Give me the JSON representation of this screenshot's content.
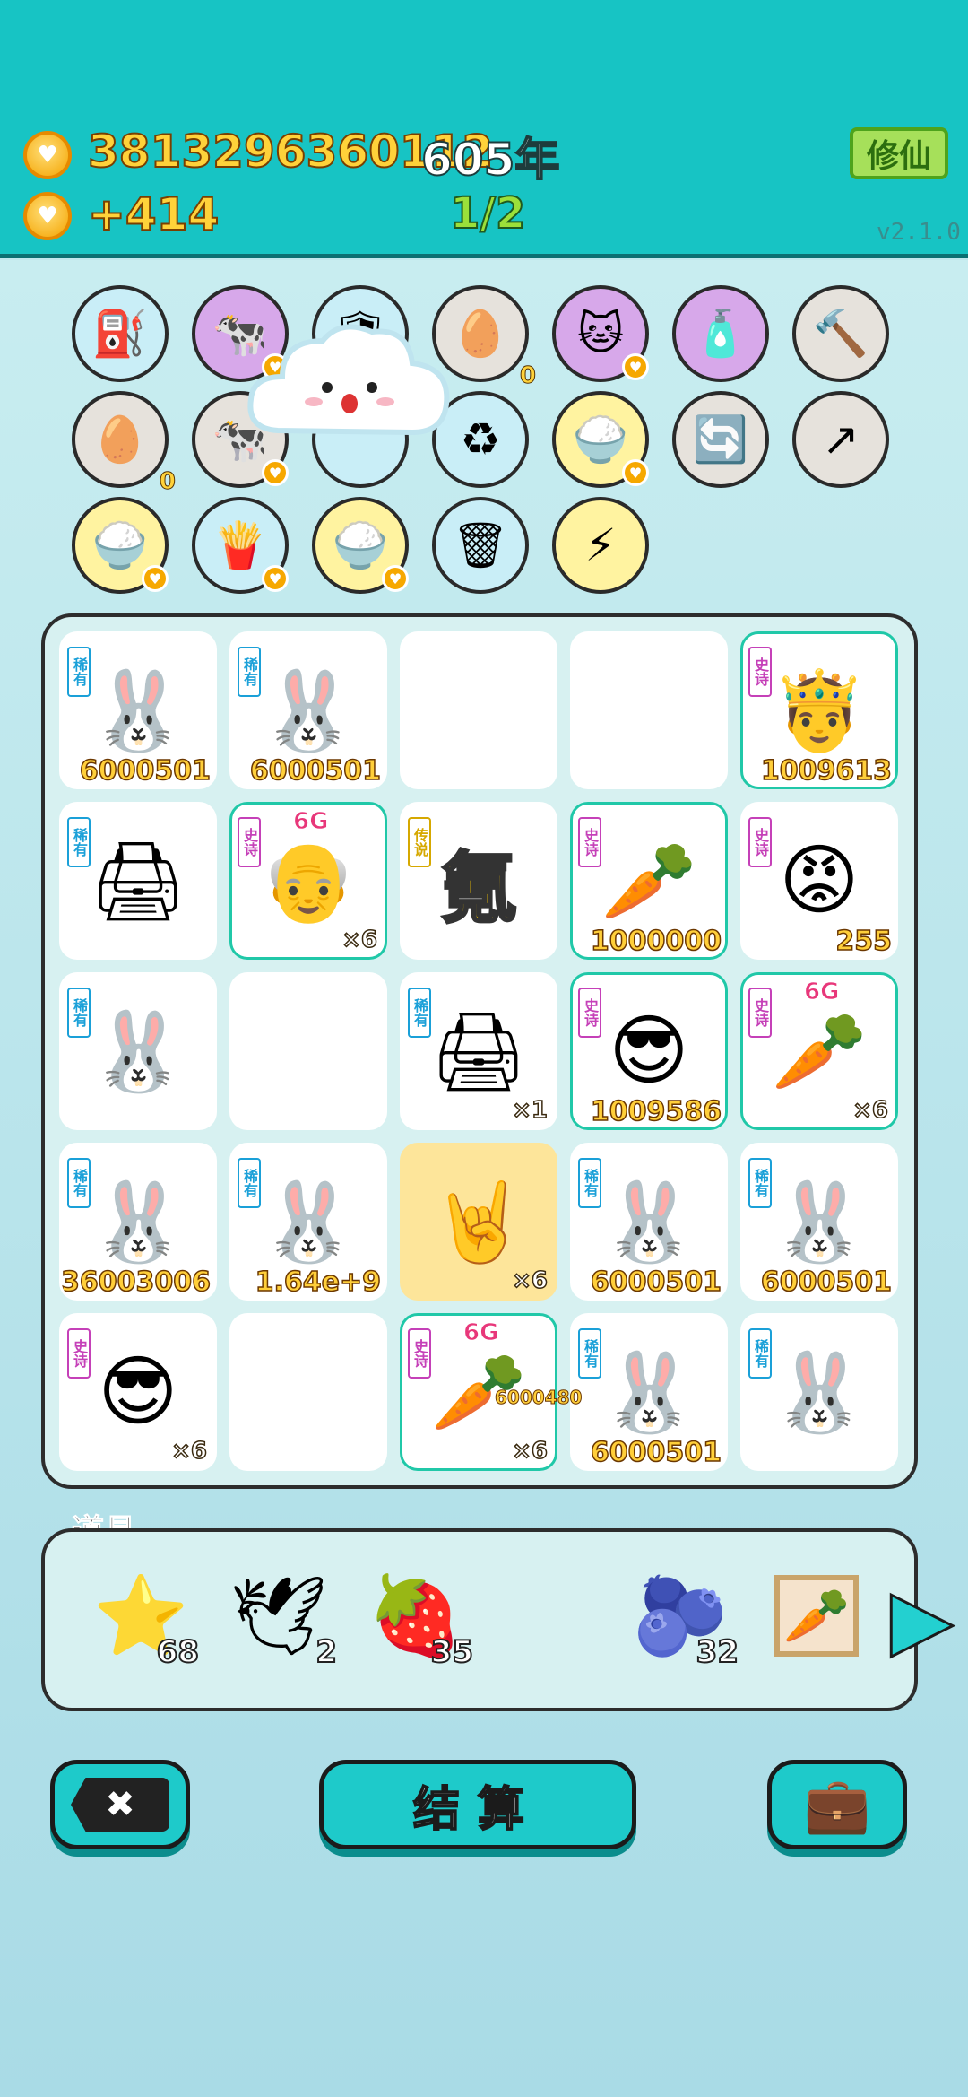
{
  "header": {
    "coins_value": "3813296360112",
    "year_text": "605年",
    "rate_text": "+414",
    "progress_text": "1/2",
    "xiuxian_label": "修仙",
    "version": "v2.1.0"
  },
  "tools": [
    {
      "icon": "pump-icon",
      "glyph": "⛽",
      "bg": "#c9eef7",
      "badge": false,
      "count": ""
    },
    {
      "icon": "cows-icon",
      "glyph": "🐄",
      "bg": "#d7a8ea",
      "badge": true,
      "count": ""
    },
    {
      "icon": "shield-icon",
      "glyph": "🛡",
      "bg": "#c9eef7",
      "badge": false,
      "count": ""
    },
    {
      "icon": "egg-tray-icon",
      "glyph": "🥚",
      "bg": "#e6e2dc",
      "badge": false,
      "count": "0"
    },
    {
      "icon": "cat-icon",
      "glyph": "🐱",
      "bg": "#d7a8ea",
      "badge": true,
      "count": ""
    },
    {
      "icon": "spray-bottle-icon",
      "glyph": "🧴",
      "bg": "#d7a8ea",
      "badge": false,
      "count": ""
    },
    {
      "icon": "hammer-icon",
      "glyph": "🔨",
      "bg": "#e6e2dc",
      "badge": false,
      "count": ""
    },
    {
      "icon": "egg-tray-icon",
      "glyph": "🥚",
      "bg": "#e6e2dc",
      "badge": false,
      "count": "0"
    },
    {
      "icon": "cow-icon",
      "glyph": "🐄",
      "bg": "#e6e2dc",
      "badge": true,
      "count": ""
    },
    {
      "icon": "hidden-icon",
      "glyph": "",
      "bg": "#c9eef7",
      "badge": false,
      "count": ""
    },
    {
      "icon": "recycle-bag-icon",
      "glyph": "♻",
      "bg": "#c9eef7",
      "badge": false,
      "count": ""
    },
    {
      "icon": "rice-bowl-icon",
      "glyph": "🍚",
      "bg": "#fff3a0",
      "badge": true,
      "count": ""
    },
    {
      "icon": "refresh-lightning-icon",
      "glyph": "🔄",
      "bg": "#e6e2dc",
      "badge": false,
      "count": ""
    },
    {
      "icon": "arrow-lightning-icon",
      "glyph": "↗",
      "bg": "#e6e2dc",
      "badge": false,
      "count": ""
    },
    {
      "icon": "rice-bowl-icon",
      "glyph": "🍚",
      "bg": "#fff3a0",
      "badge": true,
      "count": ""
    },
    {
      "icon": "fries-icon",
      "glyph": "🍟",
      "bg": "#c9eef7",
      "badge": true,
      "count": ""
    },
    {
      "icon": "rice-bowl-icon",
      "glyph": "🍚",
      "bg": "#fff3a0",
      "badge": true,
      "count": ""
    },
    {
      "icon": "trash-bag-icon",
      "glyph": "🗑",
      "bg": "#c9eef7",
      "badge": false,
      "count": ""
    },
    {
      "icon": "lightning-icon",
      "glyph": "⚡",
      "bg": "#fff3a0",
      "badge": false,
      "count": ""
    }
  ],
  "board": [
    {
      "tag": "稀有",
      "tag_type": "rare",
      "icon": "rabbit-icon",
      "glyph": "🐰",
      "num": "6000501",
      "mult": "",
      "g6": "",
      "style": ""
    },
    {
      "tag": "稀有",
      "tag_type": "rare",
      "icon": "rabbit-icon",
      "glyph": "🐰",
      "num": "6000501",
      "mult": "",
      "g6": "",
      "style": ""
    },
    {
      "tag": "",
      "tag_type": "",
      "icon": "empty-icon",
      "glyph": "",
      "num": "",
      "mult": "",
      "g6": "",
      "style": ""
    },
    {
      "tag": "",
      "tag_type": "",
      "icon": "empty-icon",
      "glyph": "",
      "num": "",
      "mult": "",
      "g6": "",
      "style": ""
    },
    {
      "tag": "史诗",
      "tag_type": "epic",
      "icon": "crowned-man-icon",
      "glyph": "🤴",
      "num": "1009613",
      "mult": "",
      "g6": "",
      "style": "epic"
    },
    {
      "tag": "稀有",
      "tag_type": "rare",
      "icon": "printer-icon",
      "glyph": "🖨",
      "num": "",
      "mult": "",
      "g6": "",
      "style": ""
    },
    {
      "tag": "史诗",
      "tag_type": "epic",
      "icon": "crowned-grandpa-icon",
      "glyph": "👴",
      "num": "",
      "mult": "×6",
      "g6": "6G",
      "style": "epic"
    },
    {
      "tag": "传说",
      "tag_type": "leg",
      "icon": "character-icon",
      "glyph": "氪",
      "num": "",
      "mult": "",
      "g6": "",
      "style": ""
    },
    {
      "tag": "史诗",
      "tag_type": "epic",
      "icon": "carrot-icon",
      "glyph": "🥕",
      "num": "1000000",
      "mult": "",
      "g6": "",
      "style": "epic"
    },
    {
      "tag": "史诗",
      "tag_type": "epic",
      "icon": "angry-face-icon",
      "glyph": "😡",
      "num": "255",
      "mult": "",
      "g6": "",
      "style": ""
    },
    {
      "tag": "稀有",
      "tag_type": "rare",
      "icon": "rabbit-icon",
      "glyph": "🐰",
      "num": "",
      "mult": "",
      "g6": "",
      "style": ""
    },
    {
      "tag": "",
      "tag_type": "",
      "icon": "empty-icon",
      "glyph": "",
      "num": "",
      "mult": "",
      "g6": "",
      "style": ""
    },
    {
      "tag": "稀有",
      "tag_type": "rare",
      "icon": "broken-printer-icon",
      "glyph": "🖨",
      "num": "",
      "mult": "×1",
      "g6": "",
      "style": ""
    },
    {
      "tag": "史诗",
      "tag_type": "epic",
      "icon": "sunglasses-man-icon",
      "glyph": "😎",
      "num": "1009586",
      "mult": "",
      "g6": "",
      "style": "epic"
    },
    {
      "tag": "史诗",
      "tag_type": "epic",
      "icon": "crowned-carrot-icon",
      "glyph": "🥕",
      "num": "",
      "mult": "×6",
      "g6": "6G",
      "style": "epic"
    },
    {
      "tag": "稀有",
      "tag_type": "rare",
      "icon": "rabbit-icon",
      "glyph": "🐰",
      "num": "36003006",
      "mult": "",
      "g6": "",
      "style": ""
    },
    {
      "tag": "稀有",
      "tag_type": "rare",
      "icon": "rabbit-icon",
      "glyph": "🐰",
      "num": "1.64e+9",
      "mult": "",
      "g6": "",
      "style": ""
    },
    {
      "tag": "",
      "tag_type": "",
      "icon": "rock-hand-icon",
      "glyph": "🤘",
      "num": "",
      "mult": "×6",
      "g6": "",
      "style": "yellow"
    },
    {
      "tag": "稀有",
      "tag_type": "rare",
      "icon": "rabbit-icon",
      "glyph": "🐰",
      "num": "6000501",
      "mult": "",
      "g6": "",
      "style": ""
    },
    {
      "tag": "稀有",
      "tag_type": "rare",
      "icon": "rabbit-icon",
      "glyph": "🐰",
      "num": "6000501",
      "mult": "",
      "g6": "",
      "style": ""
    },
    {
      "tag": "史诗",
      "tag_type": "epic",
      "icon": "sunglasses-man-icon",
      "glyph": "😎",
      "num": "",
      "mult": "×6",
      "g6": "",
      "style": ""
    },
    {
      "tag": "",
      "tag_type": "",
      "icon": "empty-icon",
      "glyph": "",
      "num": "",
      "mult": "",
      "g6": "",
      "style": ""
    },
    {
      "tag": "史诗",
      "tag_type": "epic",
      "icon": "carrot-icon",
      "glyph": "🥕",
      "num": "",
      "mult": "×6",
      "g6": "6G",
      "style": "epic"
    },
    {
      "tag": "稀有",
      "tag_type": "rare",
      "icon": "rabbit-icon",
      "glyph": "🐰",
      "num": "6000501",
      "mult": "",
      "g6": "",
      "style": ""
    },
    {
      "tag": "稀有",
      "tag_type": "rare",
      "icon": "rabbit-icon",
      "glyph": "🐰",
      "num": "",
      "mult": "",
      "g6": "",
      "style": ""
    }
  ],
  "floating_text": "6000480",
  "props_label": "道具",
  "props": [
    {
      "icon": "star-icon",
      "glyph": "⭐",
      "count": "68"
    },
    {
      "icon": "duck-icon",
      "glyph": "🕊",
      "count": "2"
    },
    {
      "icon": "strawberry-icon",
      "glyph": "🍓",
      "count": "35"
    },
    {
      "icon": "blueberry-icon",
      "glyph": "🫐",
      "count": "32"
    },
    {
      "icon": "carrot-frame-icon",
      "glyph": "🥕",
      "count": ""
    }
  ],
  "buttons": {
    "close_glyph": "✖",
    "settle_label": "结算",
    "bag_glyph": "💼"
  }
}
